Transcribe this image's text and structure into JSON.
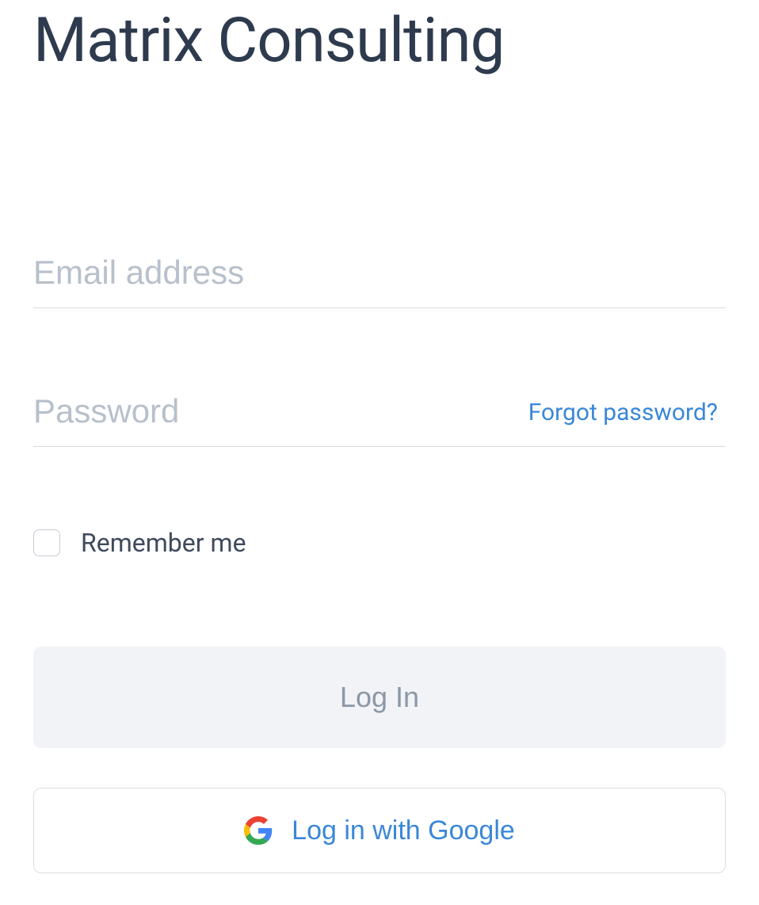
{
  "title": "Matrix Consulting",
  "form": {
    "email_placeholder": "Email address",
    "email_value": "",
    "password_placeholder": "Password",
    "password_value": "",
    "forgot_password_label": "Forgot password?",
    "remember_me_label": "Remember me",
    "remember_me_checked": false,
    "login_button_label": "Log In",
    "google_button_label": "Log in with Google"
  },
  "colors": {
    "title_text": "#2e3b4e",
    "placeholder": "#b7c0cb",
    "link_blue": "#3a87d8",
    "disabled_button_bg": "#f1f3f6",
    "disabled_button_text": "#8c97a6",
    "border": "#d8dde3"
  }
}
